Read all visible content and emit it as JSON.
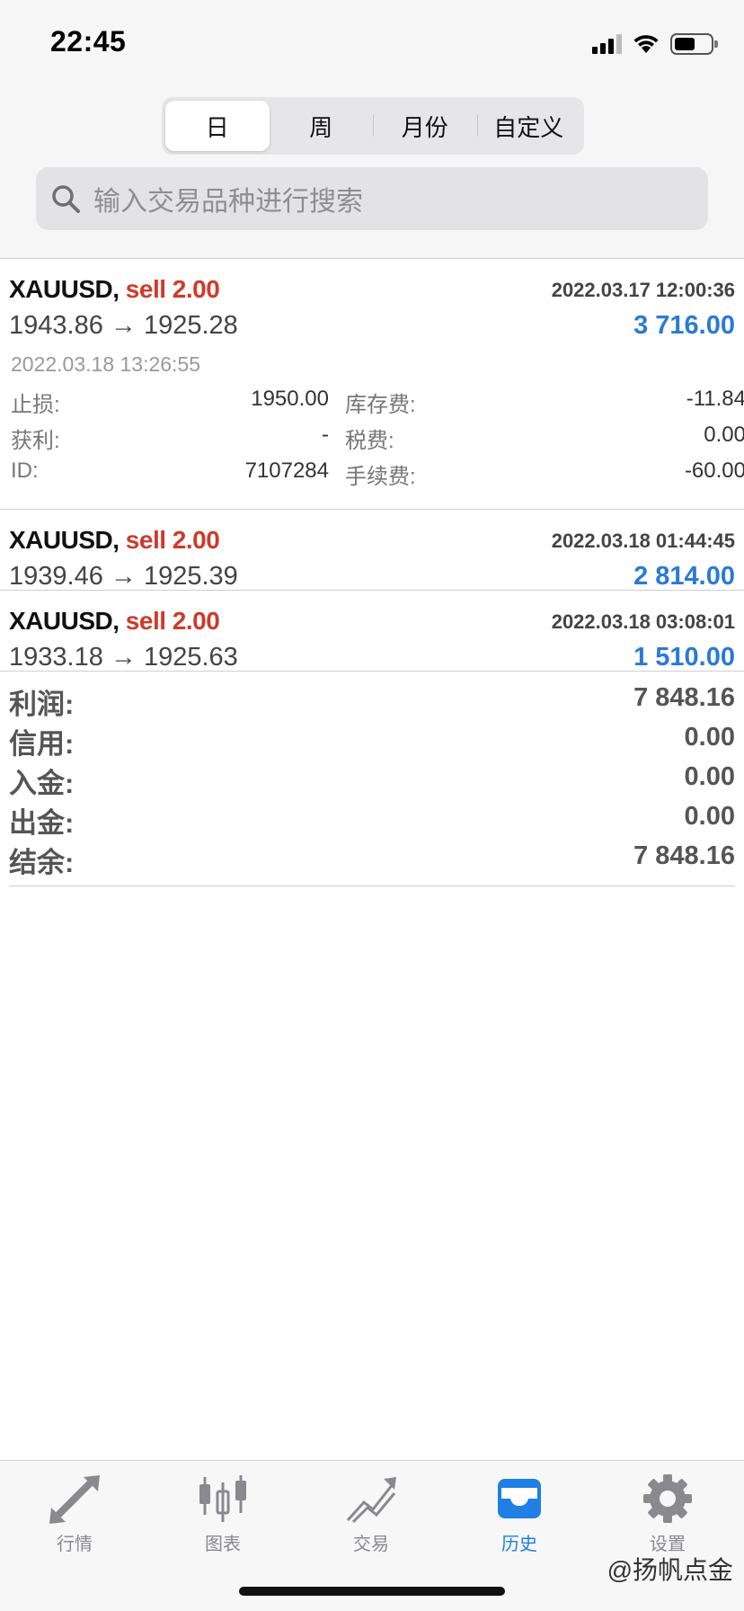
{
  "status_bar": {
    "time": "22:45"
  },
  "period_tabs": [
    "日",
    "周",
    "月份",
    "自定义"
  ],
  "active_tab": "日",
  "search": {
    "placeholder": "输入交易品种进行搜索"
  },
  "deals": [
    {
      "symbol": "XAUUSD,",
      "type": "sell 2.00",
      "open_time": "2022.03.17 12:00:36",
      "prices": "1943.86 → 1925.28",
      "profit": "3 716.00",
      "close_time": "2022.03.18 13:26:55",
      "details": {
        "stop_loss_label": "止损:",
        "stop_loss": "1950.00",
        "swap_label": "库存费:",
        "swap": "-11.84",
        "take_profit_label": "获利:",
        "take_profit": "-",
        "taxes_label": "税费:",
        "taxes": "0.00",
        "id_label": "ID:",
        "id": "7107284",
        "commission_label": "手续费:",
        "commission": "-60.00"
      }
    },
    {
      "symbol": "XAUUSD,",
      "type": "sell 2.00",
      "open_time": "2022.03.18 01:44:45",
      "prices": "1939.46 → 1925.39",
      "profit": "2 814.00"
    },
    {
      "symbol": "XAUUSD,",
      "type": "sell 2.00",
      "open_time": "2022.03.18 03:08:01",
      "prices": "1933.18 → 1925.63",
      "profit": "1 510.00"
    }
  ],
  "summary": [
    {
      "label": "利润:",
      "value": "7 848.16"
    },
    {
      "label": "信用:",
      "value": "0.00"
    },
    {
      "label": "入金:",
      "value": "0.00"
    },
    {
      "label": "出金:",
      "value": "0.00"
    },
    {
      "label": "结余:",
      "value": "7 848.16"
    }
  ],
  "tab_bar": [
    {
      "label": "行情",
      "icon": "quotes-arrows-icon"
    },
    {
      "label": "图表",
      "icon": "candlestick-chart-icon"
    },
    {
      "label": "交易",
      "icon": "trade-chart-icon"
    },
    {
      "label": "历史",
      "icon": "history-inbox-icon"
    },
    {
      "label": "设置",
      "icon": "gear-icon"
    }
  ],
  "watermark": "@扬帆点金",
  "colors": {
    "sell": "#cf3a2a",
    "profit": "#2a7ad5",
    "active_tab": "#1f7fe4",
    "inactive_tab": "#8a8a8e"
  }
}
